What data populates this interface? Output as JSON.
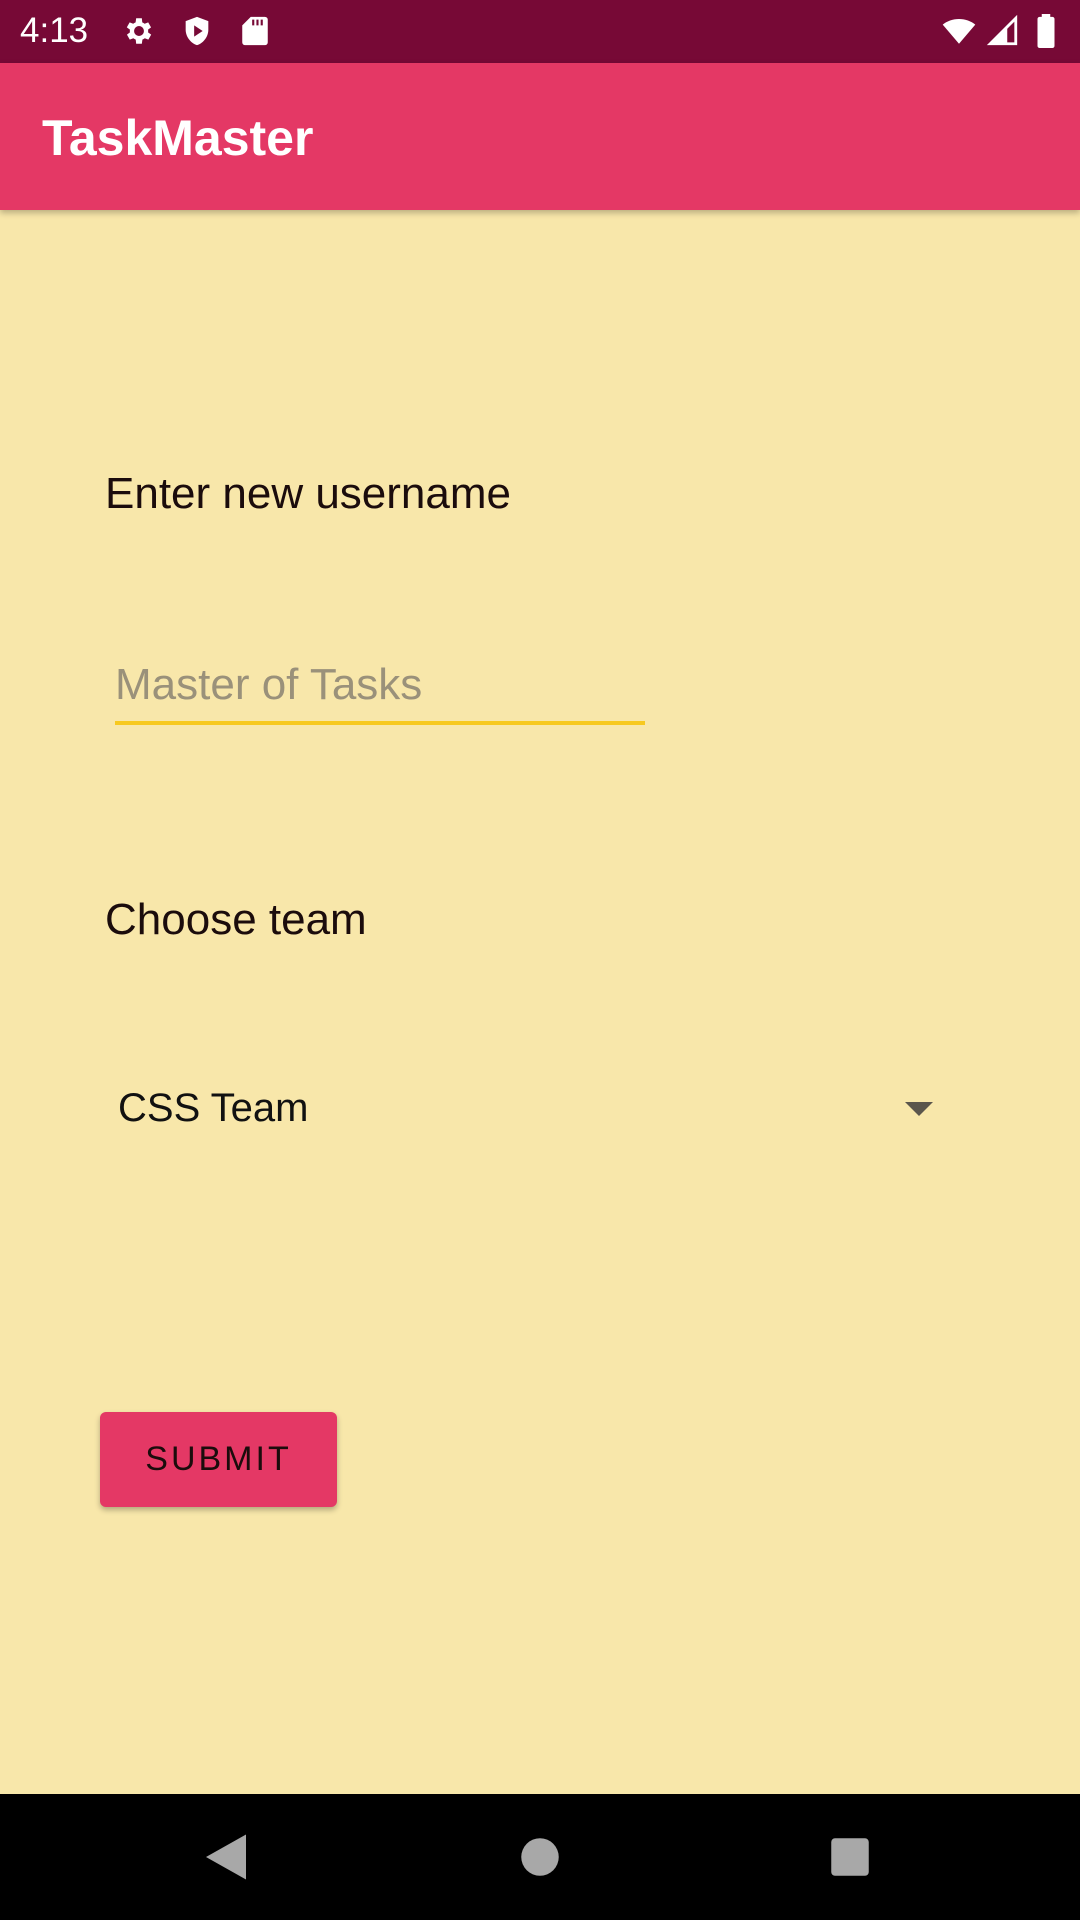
{
  "status_bar": {
    "time": "4:13",
    "left_icons": [
      "gear-icon",
      "shield-icon",
      "sd-card-icon"
    ],
    "right_icons": [
      "wifi-icon",
      "signal-icon",
      "battery-icon"
    ]
  },
  "app_bar": {
    "title": "TaskMaster"
  },
  "form": {
    "username_label": "Enter new username",
    "username_placeholder": "Master of Tasks",
    "username_value": "",
    "team_label": "Choose team",
    "team_selected": "CSS Team",
    "submit_label": "SUBMIT"
  },
  "nav_bar": {
    "buttons": [
      "back-icon",
      "home-icon",
      "recents-icon"
    ]
  },
  "colors": {
    "status_bar": "#770936",
    "app_bar": "#e43865",
    "background": "#f8e7aa",
    "input_underline": "#f7c91f",
    "button": "#e43865"
  }
}
